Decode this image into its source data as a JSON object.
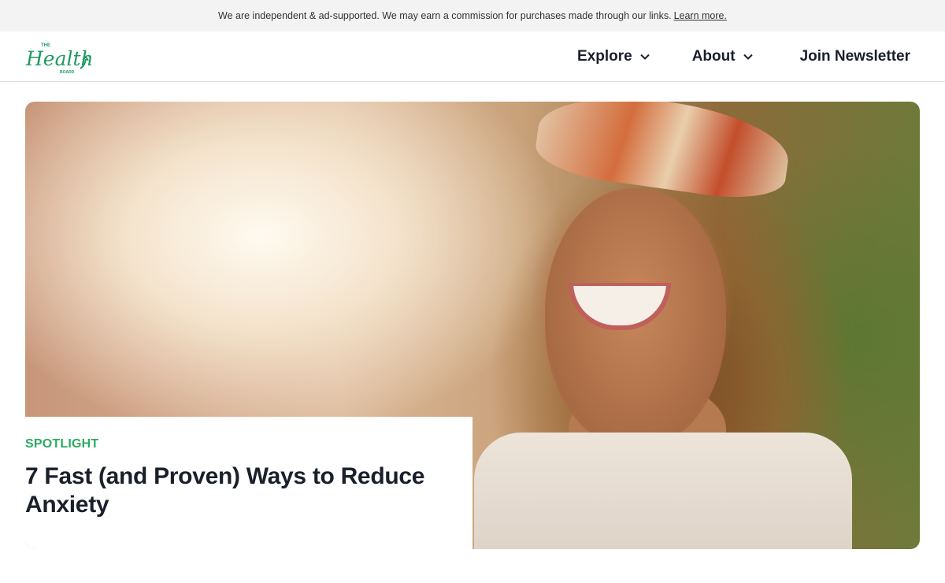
{
  "topbar": {
    "disclaimer": "We are independent & ad-supported. We may earn a commission for purchases made through our links.",
    "learn_more": "Learn more."
  },
  "header": {
    "logo_top": "THE",
    "logo_main": "Health",
    "logo_sub": "BOARD",
    "brand_color": "#1f9a62",
    "nav": {
      "explore": "Explore",
      "about": "About",
      "join": "Join Newsletter"
    }
  },
  "hero": {
    "category": "SPOTLIGHT",
    "title": "7 Fast (and Proven) Ways to Reduce Anxiety",
    "image_subject": "smiling-woman-photo",
    "accent_color": "#2bab62"
  }
}
